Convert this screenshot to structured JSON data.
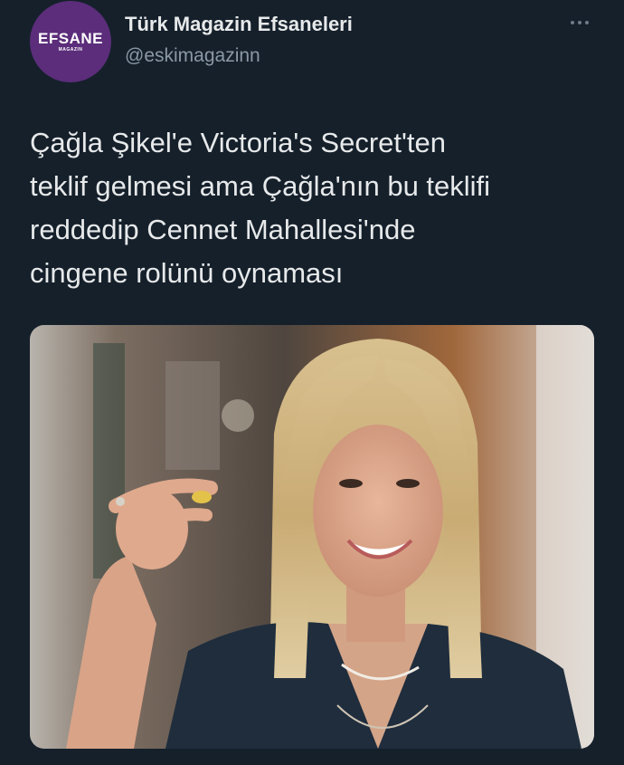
{
  "account": {
    "display_name": "Türk Magazin Efsaneleri",
    "handle": "@eskimagazinn",
    "avatar_logo": "EFSANE",
    "avatar_subtext": "MAGAZIN",
    "avatar_color": "#5b2d7a"
  },
  "more_button": {
    "icon": "more-horizontal-icon"
  },
  "tweet": {
    "text": "Çağla Şikel'e Victoria's Secret'ten\nteklif gelmesi ama Çağla'nın bu teklifi\nreddedip Cennet Mahallesi'nde\ncingene rolünü oynaması"
  },
  "media": {
    "type": "photo",
    "subject": "blonde woman in dark blazer smiling, holding small capsule"
  },
  "colors": {
    "background": "#15202b",
    "primary_text": "#e7e9ea",
    "secondary_text": "#8b98a5"
  }
}
